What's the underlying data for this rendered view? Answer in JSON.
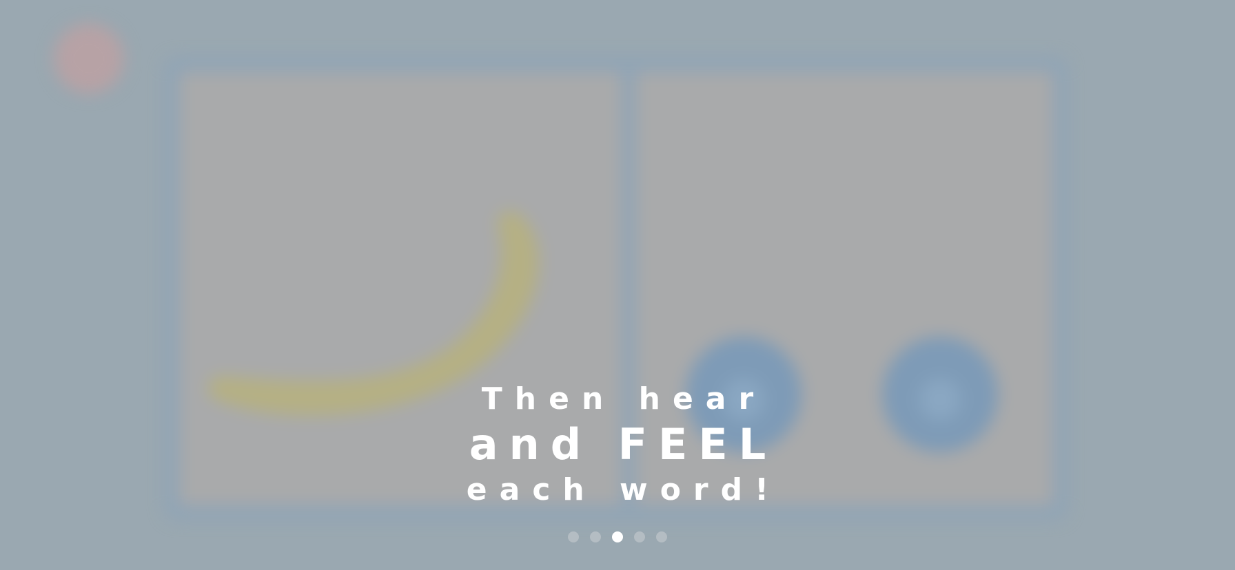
{
  "overlay": {
    "line1": "Then hear",
    "line2": "and FEEL",
    "line3": "each word!"
  },
  "pagination": {
    "total": 5,
    "active_index": 2
  },
  "background": {
    "close_button_icon": "close-icon",
    "left_panel_image": "banana-image",
    "right_panel_buttons": [
      "sound-button-icon",
      "sound-button-icon"
    ]
  },
  "colors": {
    "overlay_tint": "#9aa8b1",
    "card_border": "#8fa4b6",
    "card_fill": "#a9aaab",
    "banana": "#b5b084",
    "close_button": "#b7a2a5",
    "sound_button": "#7e9bb7",
    "dot_active": "#ffffff",
    "dot_inactive": "#b4bdc3",
    "text": "#ffffff"
  }
}
